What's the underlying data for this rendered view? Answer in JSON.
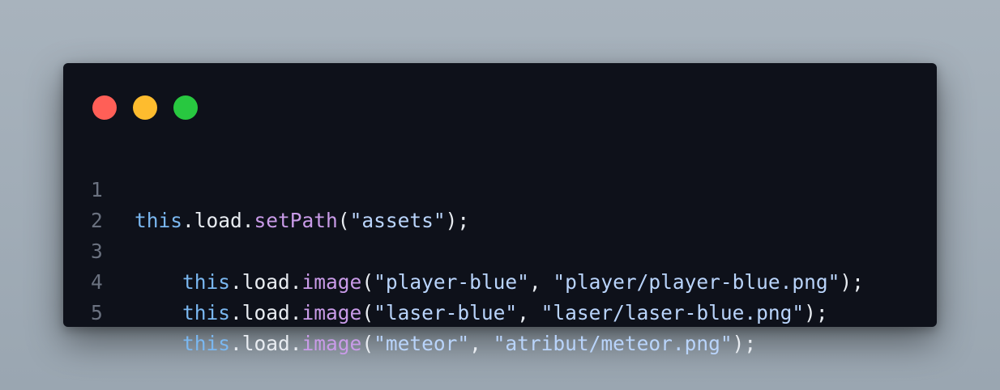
{
  "colors": {
    "dot_red": "#ff5f57",
    "dot_yellow": "#febc2e",
    "dot_green": "#28c840",
    "window_bg": "#0e111a",
    "keyword_this": "#7ab7f0",
    "function": "#c99be8",
    "string": "#b9d4fb",
    "plain": "#e8ecf1",
    "line_number": "#6b7280"
  },
  "lines": [
    {
      "number": "1",
      "tokens": [
        {
          "type": "this",
          "text": "this"
        },
        {
          "type": "plain",
          "text": ".load."
        },
        {
          "type": "fn",
          "text": "setPath"
        },
        {
          "type": "plain",
          "text": "("
        },
        {
          "type": "str",
          "text": "\"assets\""
        },
        {
          "type": "plain",
          "text": ");"
        }
      ]
    },
    {
      "number": "2",
      "tokens": []
    },
    {
      "number": "3",
      "tokens": [
        {
          "type": "plain",
          "text": "    "
        },
        {
          "type": "this",
          "text": "this"
        },
        {
          "type": "plain",
          "text": ".load."
        },
        {
          "type": "fn",
          "text": "image"
        },
        {
          "type": "plain",
          "text": "("
        },
        {
          "type": "str",
          "text": "\"player-blue\""
        },
        {
          "type": "plain",
          "text": ", "
        },
        {
          "type": "str",
          "text": "\"player/player-blue.png\""
        },
        {
          "type": "plain",
          "text": ");"
        }
      ]
    },
    {
      "number": "4",
      "tokens": [
        {
          "type": "plain",
          "text": "    "
        },
        {
          "type": "this",
          "text": "this"
        },
        {
          "type": "plain",
          "text": ".load."
        },
        {
          "type": "fn",
          "text": "image"
        },
        {
          "type": "plain",
          "text": "("
        },
        {
          "type": "str",
          "text": "\"laser-blue\""
        },
        {
          "type": "plain",
          "text": ", "
        },
        {
          "type": "str",
          "text": "\"laser/laser-blue.png\""
        },
        {
          "type": "plain",
          "text": ");"
        }
      ]
    },
    {
      "number": "5",
      "tokens": [
        {
          "type": "plain",
          "text": "    "
        },
        {
          "type": "this",
          "text": "this"
        },
        {
          "type": "plain",
          "text": ".load."
        },
        {
          "type": "fn",
          "text": "image"
        },
        {
          "type": "plain",
          "text": "("
        },
        {
          "type": "str",
          "text": "\"meteor\""
        },
        {
          "type": "plain",
          "text": ", "
        },
        {
          "type": "str",
          "text": "\"atribut/meteor.png\""
        },
        {
          "type": "plain",
          "text": ");"
        }
      ]
    }
  ]
}
